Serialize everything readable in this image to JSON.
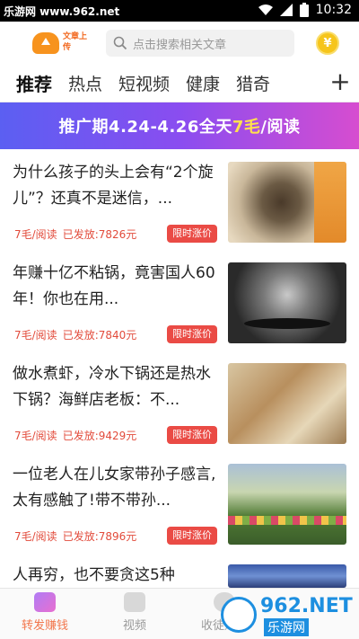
{
  "status_bar": {
    "site": "乐游网 www.962.net",
    "time": "10:32"
  },
  "header": {
    "logo_text": "文章上传",
    "search_placeholder": "点击搜索相关文章",
    "coin_symbol": "¥"
  },
  "tabs": [
    {
      "label": "推荐",
      "active": true
    },
    {
      "label": "热点",
      "active": false
    },
    {
      "label": "短视频",
      "active": false
    },
    {
      "label": "健康",
      "active": false
    },
    {
      "label": "猎奇",
      "active": false
    }
  ],
  "tab_add": "+",
  "banner": {
    "prefix": "推广期4.24-4.26全天",
    "highlight": "7毛",
    "suffix": "/阅读"
  },
  "articles": [
    {
      "title": "为什么孩子的头上会有“2个旋儿”？还真不是迷信，...",
      "rate": "7毛/阅读",
      "paid": "已发放:7826元",
      "tag": "限时涨价"
    },
    {
      "title": "年赚十亿不粘锅，竟害国人60年！你也在用...",
      "rate": "7毛/阅读",
      "paid": "已发放:7840元",
      "tag": "限时涨价"
    },
    {
      "title": "做水煮虾，冷水下锅还是热水下锅？海鲜店老板：不...",
      "rate": "7毛/阅读",
      "paid": "已发放:9429元",
      "tag": "限时涨价"
    },
    {
      "title": "一位老人在儿女家带孙子感言,太有感触了!带不带孙...",
      "rate": "7毛/阅读",
      "paid": "已发放:7896元",
      "tag": "限时涨价"
    },
    {
      "title": "人再穷，也不要贪这5种",
      "rate": "",
      "paid": "",
      "tag": ""
    }
  ],
  "bottom_nav": [
    {
      "label": "转发赚钱",
      "active": true
    },
    {
      "label": "视频",
      "active": false
    },
    {
      "label": "收徒赚钱",
      "active": false
    }
  ],
  "watermark": {
    "main": "962.NET",
    "sub": "乐游网"
  },
  "colors": {
    "accent": "#f2764c",
    "price": "#e24b3b",
    "tag_bg": "#ea4b45",
    "banner_highlight": "#ffe14d"
  }
}
